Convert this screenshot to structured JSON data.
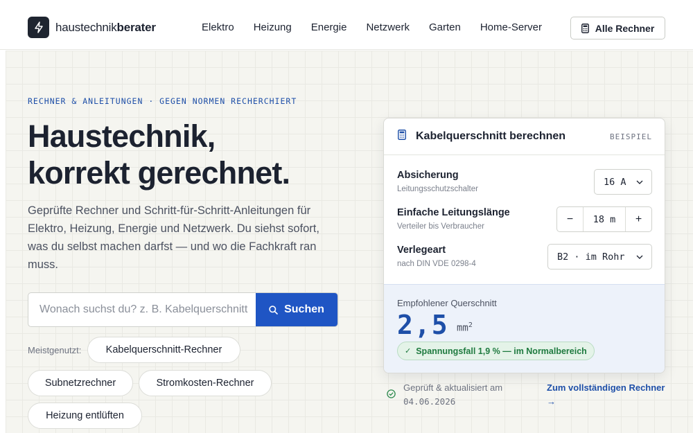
{
  "brand": {
    "name_regular": "haustechnik",
    "name_bold": "berater",
    "logo_icon": "lightning-icon"
  },
  "nav": {
    "items": [
      {
        "label": "Elektro"
      },
      {
        "label": "Heizung"
      },
      {
        "label": "Energie"
      },
      {
        "label": "Netzwerk"
      },
      {
        "label": "Garten"
      },
      {
        "label": "Home-Server"
      }
    ],
    "all_button": {
      "label": "Alle Rechner",
      "icon": "calculator-icon"
    }
  },
  "hero": {
    "eyebrow": "RECHNER & ANLEITUNGEN · GEGEN NORMEN RECHERCHIERT",
    "headline_line1": "Haustechnik,",
    "headline_line2": "korrekt gerechnet.",
    "lead": "Geprüfte Rechner und Schritt-für-Schritt-Anleitungen für Elektro, Heizung, Energie und Netzwerk. Du siehst sofort, was du selbst machen darfst — und wo die Fachkraft ran muss."
  },
  "search": {
    "placeholder": "Wonach suchst du? z. B. Kabelquerschnitt",
    "value": "",
    "button_label": "Suchen",
    "button_icon": "search-icon"
  },
  "popular": {
    "label": "Meistgenutzt:",
    "chips": [
      {
        "label": "Kabelquerschnitt-Rechner"
      },
      {
        "label": "Subnetzrechner"
      },
      {
        "label": "Stromkosten-Rechner"
      },
      {
        "label": "Heizung entlüften"
      }
    ]
  },
  "calculator": {
    "icon": "calculator-icon",
    "title": "Kabelquerschnitt berechnen",
    "tag": "BEISPIEL",
    "rows": [
      {
        "label": "Absicherung",
        "sub": "Leitungsschutzschalter",
        "value": "16 A"
      },
      {
        "label": "Einfache Leitungslänge",
        "sub": "Verteiler bis Verbraucher",
        "value": "18 m",
        "minus": "−",
        "plus": "+"
      },
      {
        "label": "Verlegeart",
        "sub": "nach DIN VDE 0298-4",
        "value": "B2 · im Rohr"
      }
    ],
    "result": {
      "label": "Empfohlener Querschnitt",
      "value": "2,5",
      "unit": "mm",
      "unit_exp": "2",
      "badge": "Spannungsfall 1,9 % — im Normalbereich",
      "badge_icon": "check-icon"
    }
  },
  "meta": {
    "verified_label": "Geprüft & aktualisiert am",
    "verified_date": "04.06.2026",
    "verified_icon": "check-circle-icon",
    "full_link": "Zum vollständigen Rechner →"
  },
  "colors": {
    "accent": "#1f55c4",
    "accent_text": "#1e4fa8",
    "ink": "#1c2230",
    "success": "#1e7a3f",
    "result_bg": "#edf2fa",
    "hero_bg": "#f5f5f0"
  }
}
